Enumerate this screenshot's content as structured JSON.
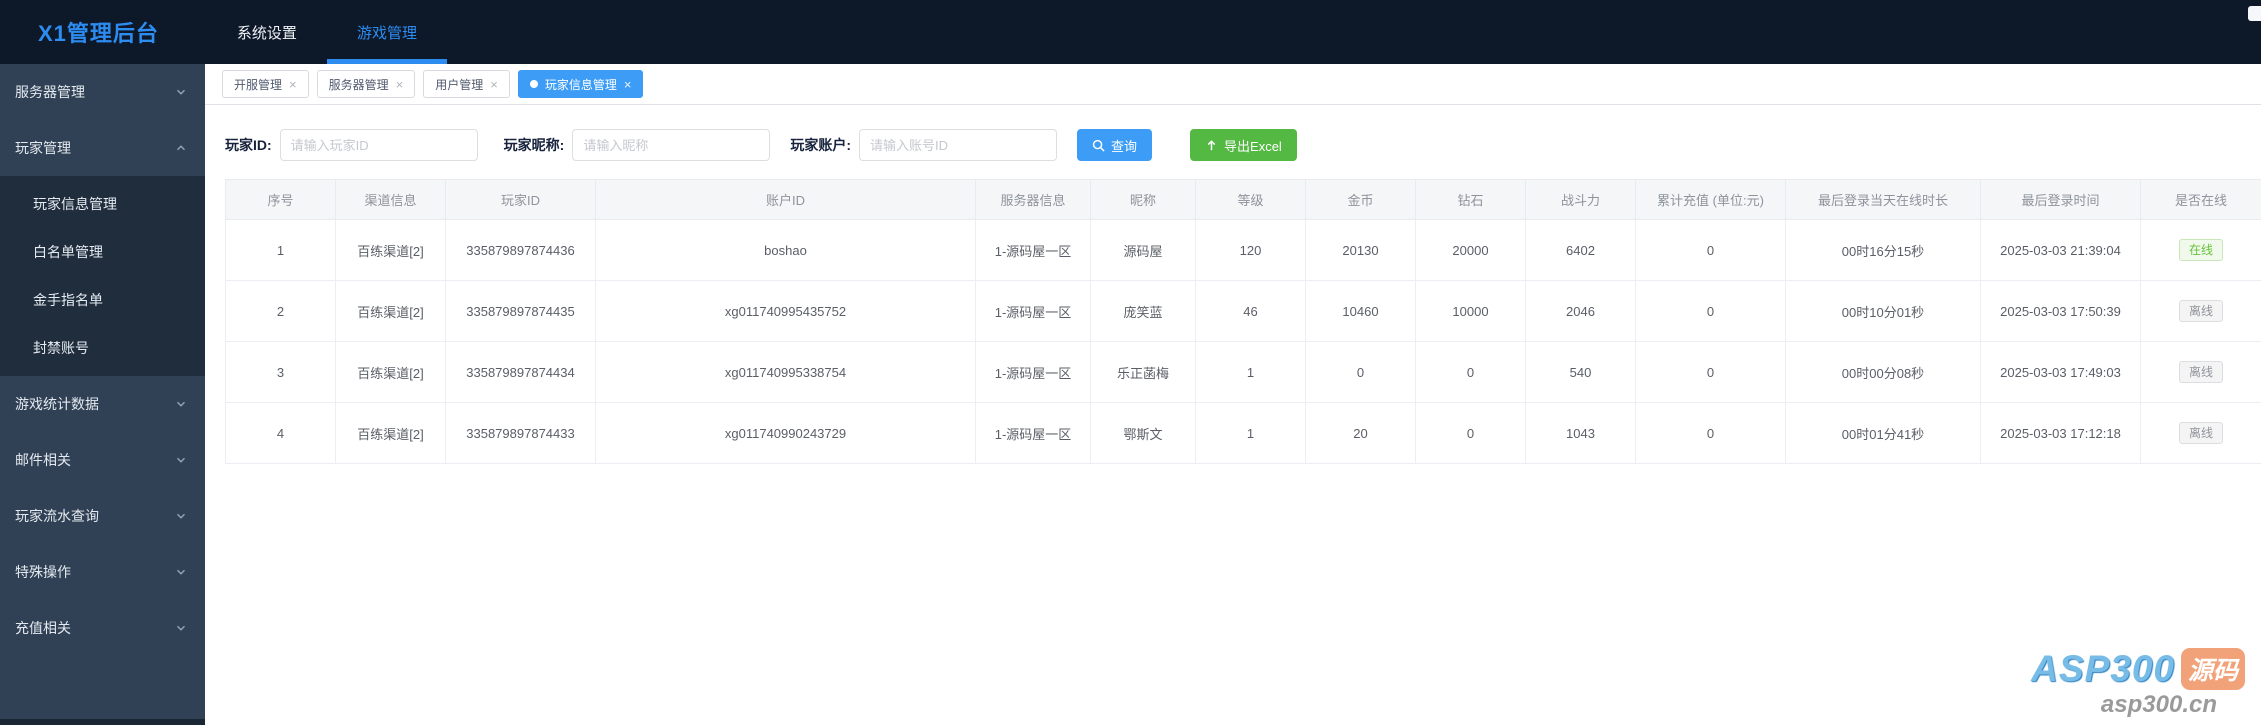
{
  "topbar": {
    "logo": "X1管理后台",
    "nav": [
      {
        "label": "系统设置",
        "active": false
      },
      {
        "label": "游戏管理",
        "active": true
      }
    ]
  },
  "sidebar": {
    "items": [
      {
        "label": "服务器管理",
        "expanded": false
      },
      {
        "label": "玩家管理",
        "expanded": true,
        "children": [
          "玩家信息管理",
          "白名单管理",
          "金手指名单",
          "封禁账号"
        ]
      },
      {
        "label": "游戏统计数据",
        "expanded": false
      },
      {
        "label": "邮件相关",
        "expanded": false
      },
      {
        "label": "玩家流水查询",
        "expanded": false
      },
      {
        "label": "特殊操作",
        "expanded": false
      },
      {
        "label": "充值相关",
        "expanded": false
      }
    ]
  },
  "tabs": [
    {
      "label": "开服管理",
      "active": false
    },
    {
      "label": "服务器管理",
      "active": false
    },
    {
      "label": "用户管理",
      "active": false
    },
    {
      "label": "玩家信息管理",
      "active": true
    }
  ],
  "ui": {
    "close_glyph": "×"
  },
  "filters": {
    "player_id": {
      "label": "玩家ID:",
      "placeholder": "请输入玩家ID",
      "value": ""
    },
    "nickname": {
      "label": "玩家昵称:",
      "placeholder": "请输入昵称",
      "value": ""
    },
    "account": {
      "label": "玩家账户:",
      "placeholder": "请输入账号ID",
      "value": ""
    },
    "search_button": "查询",
    "export_button": "导出Excel"
  },
  "status": {
    "online": "在线",
    "offline": "离线"
  },
  "table": {
    "columns": [
      "序号",
      "渠道信息",
      "玩家ID",
      "账户ID",
      "服务器信息",
      "昵称",
      "等级",
      "金币",
      "钻石",
      "战斗力",
      "累计充值 (单位:元)",
      "最后登录当天在线时长",
      "最后登录时间",
      "是否在线"
    ],
    "rows": [
      [
        "1",
        "百练渠道[2]",
        "335879897874436",
        "boshao",
        "1-源码屋一区",
        "源码屋",
        "120",
        "20130",
        "20000",
        "6402",
        "0",
        "00时16分15秒",
        "2025-03-03 21:39:04",
        "在线"
      ],
      [
        "2",
        "百练渠道[2]",
        "335879897874435",
        "xg011740995435752",
        "1-源码屋一区",
        "庞笑蓝",
        "46",
        "10460",
        "10000",
        "2046",
        "0",
        "00时10分01秒",
        "2025-03-03 17:50:39",
        "离线"
      ],
      [
        "3",
        "百练渠道[2]",
        "335879897874434",
        "xg011740995338754",
        "1-源码屋一区",
        "乐正菡梅",
        "1",
        "0",
        "0",
        "540",
        "0",
        "00时00分08秒",
        "2025-03-03 17:49:03",
        "离线"
      ],
      [
        "4",
        "百练渠道[2]",
        "335879897874433",
        "xg011740990243729",
        "1-源码屋一区",
        "鄂斯文",
        "1",
        "20",
        "0",
        "1043",
        "0",
        "00时01分41秒",
        "2025-03-03 17:12:18",
        "离线"
      ]
    ]
  },
  "watermark": {
    "brand": "ASP300",
    "badge": "源码",
    "domain": "asp300.cn"
  },
  "colors": {
    "accent_blue": "#2d8cf0",
    "tab_active_blue": "#3d9df6",
    "export_green": "#53b943",
    "online_green": "#67c23a",
    "offline_gray": "#909399",
    "topbar_bg": "#0d1829",
    "sidebar_bg": "#304156",
    "submenu_bg": "#1f2d3d"
  }
}
